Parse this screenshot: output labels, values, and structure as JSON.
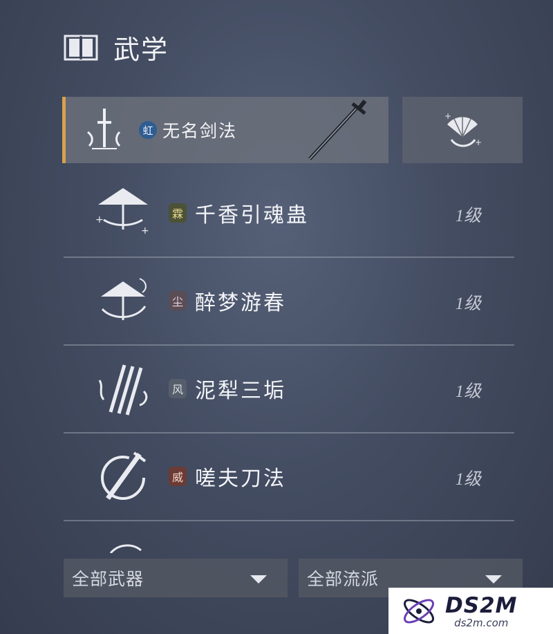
{
  "header": {
    "title": "武学",
    "icon": "book-icon"
  },
  "selected": {
    "seal": "虹",
    "name": "无名剑法",
    "icon": "sword-stance-icon",
    "weapon_icon": "sword-icon",
    "accent": "#d8a24c",
    "seal_color": "#2f5d92"
  },
  "side_tab": {
    "icon": "fan-icon"
  },
  "skills": [
    {
      "seal": "霖",
      "seal_bg": "#4b5236",
      "seal_color": "#e9d890",
      "name": "千香引魂蛊",
      "level": "1级",
      "icon": "umbrella-icon"
    },
    {
      "seal": "尘",
      "seal_bg": "#5a4d56",
      "seal_color": "#e6d3dc",
      "name": "醉梦游春",
      "level": "1级",
      "icon": "umbrella-spin-icon"
    },
    {
      "seal": "风",
      "seal_bg": "#565d6b",
      "seal_color": "#dde1e8",
      "name": "泥犁三垢",
      "level": "1级",
      "icon": "triple-blade-icon"
    },
    {
      "seal": "威",
      "seal_bg": "#6b3b35",
      "seal_color": "#f0d3c8",
      "name": "嗟夫刀法",
      "level": "1级",
      "icon": "saber-slash-icon"
    }
  ],
  "filters": {
    "weapon": "全部武器",
    "school": "全部流派"
  },
  "watermark": {
    "main": "DS2M",
    "sub": "ds2m.com"
  }
}
